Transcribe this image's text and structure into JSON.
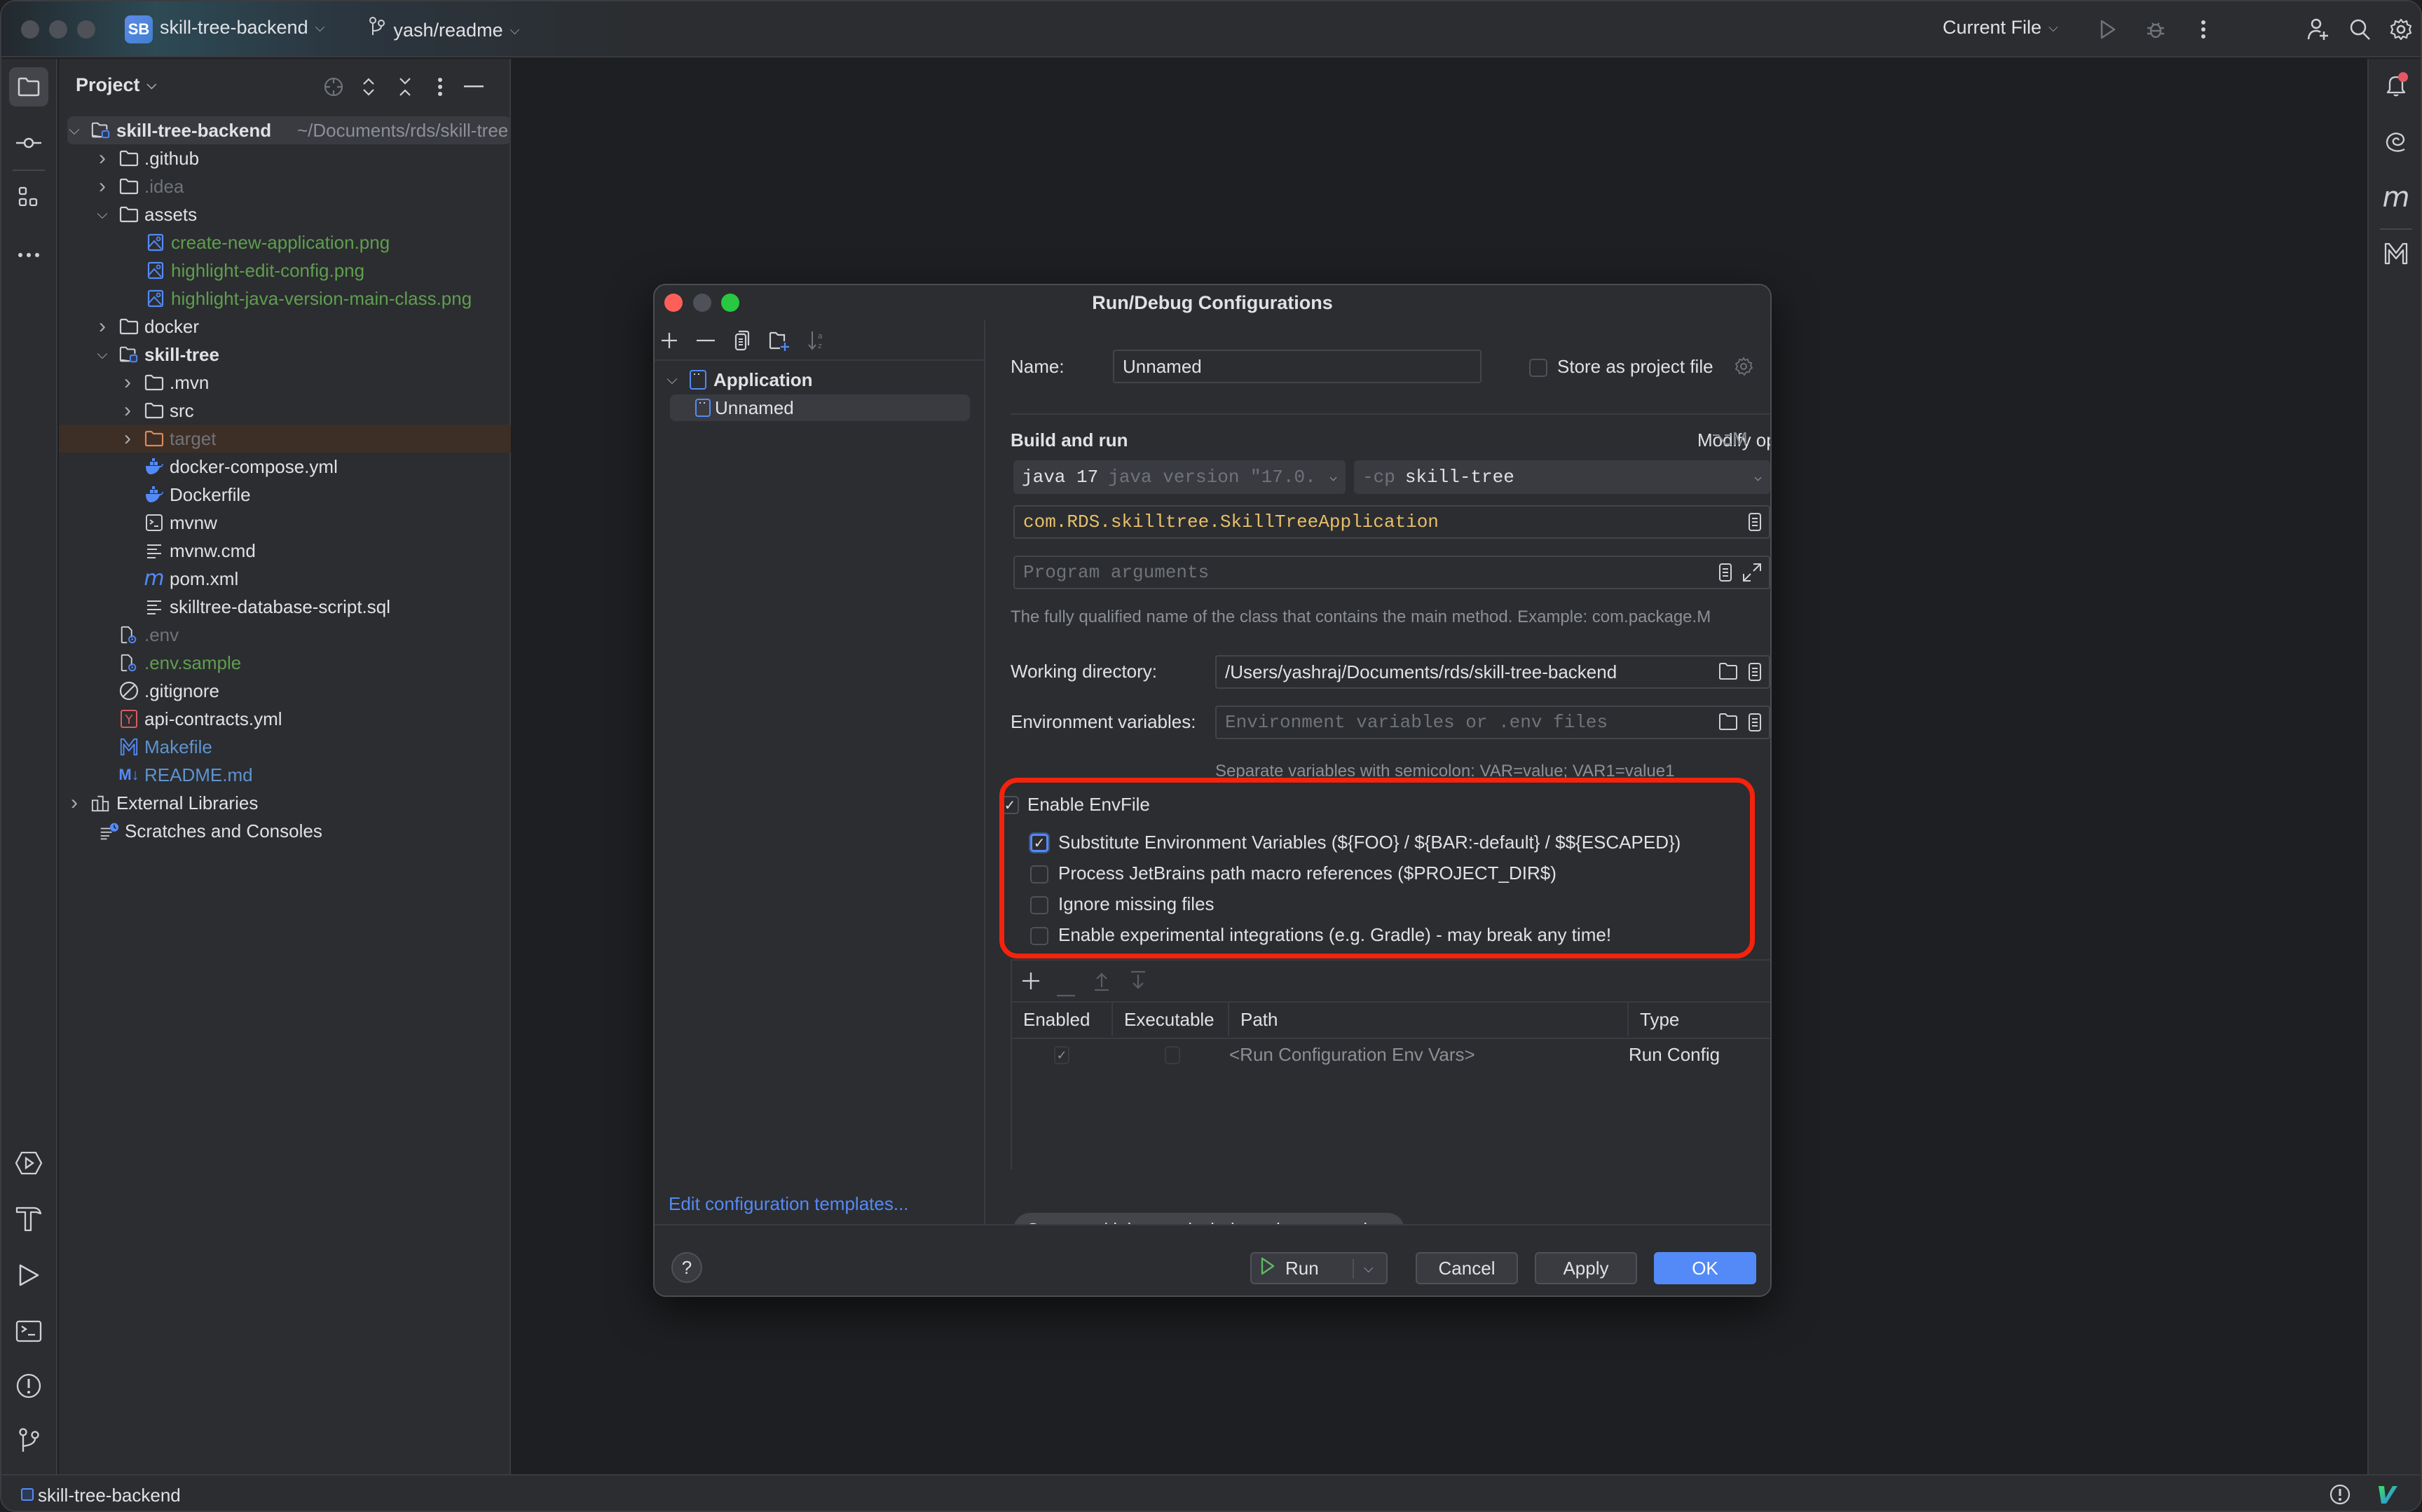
{
  "titlebar": {
    "project_badge": "SB",
    "project_name": "skill-tree-backend",
    "branch": "yash/readme",
    "run_config": "Current File",
    "icons": [
      "run-icon",
      "debug-icon",
      "more-icon",
      "add-user-icon",
      "search-icon",
      "settings-icon"
    ]
  },
  "left_strip": {
    "top_icons": [
      "project-folder-icon",
      "commit-icon",
      "structure-icon",
      "more-tools-icon"
    ],
    "bottom_icons": [
      "services-icon",
      "build-icon",
      "run-icon",
      "terminal-icon",
      "problems-icon",
      "git-icon"
    ]
  },
  "project_panel": {
    "title": "Project",
    "tree": [
      {
        "label": "skill-tree-backend",
        "extra": "~/Documents/rds/skill-tree",
        "depth": 0,
        "arrow": "open",
        "icon": "module-folder-icon",
        "style": "bold"
      },
      {
        "label": ".github",
        "depth": 1,
        "arrow": "closed",
        "icon": "folder-icon",
        "style": "normal"
      },
      {
        "label": ".idea",
        "depth": 1,
        "arrow": "closed",
        "icon": "folder-icon",
        "style": "gray"
      },
      {
        "label": "assets",
        "depth": 1,
        "arrow": "open",
        "icon": "folder-icon",
        "style": "normal"
      },
      {
        "label": "create-new-application.png",
        "depth": 2,
        "arrow": "none",
        "icon": "image-file-icon",
        "style": "green"
      },
      {
        "label": "highlight-edit-config.png",
        "depth": 2,
        "arrow": "none",
        "icon": "image-file-icon",
        "style": "green"
      },
      {
        "label": "highlight-java-version-main-class.png",
        "depth": 2,
        "arrow": "none",
        "icon": "image-file-icon",
        "style": "green"
      },
      {
        "label": "docker",
        "depth": 1,
        "arrow": "closed",
        "icon": "folder-icon",
        "style": "normal"
      },
      {
        "label": "skill-tree",
        "depth": 1,
        "arrow": "open",
        "icon": "module-folder-icon",
        "style": "bold"
      },
      {
        "label": ".mvn",
        "depth": 2,
        "arrow": "closed",
        "icon": "folder-icon",
        "style": "normal"
      },
      {
        "label": "src",
        "depth": 2,
        "arrow": "closed",
        "icon": "folder-icon",
        "style": "normal"
      },
      {
        "label": "target",
        "depth": 2,
        "arrow": "closed",
        "icon": "excluded-folder-icon",
        "style": "gray",
        "excluded": true
      },
      {
        "label": "docker-compose.yml",
        "depth": 3,
        "arrow": "none",
        "icon": "docker-icon",
        "style": "normal"
      },
      {
        "label": "Dockerfile",
        "depth": 3,
        "arrow": "none",
        "icon": "docker-icon",
        "style": "normal"
      },
      {
        "label": "mvnw",
        "depth": 3,
        "arrow": "none",
        "icon": "shell-script-icon",
        "style": "normal"
      },
      {
        "label": "mvnw.cmd",
        "depth": 3,
        "arrow": "none",
        "icon": "text-file-icon",
        "style": "normal"
      },
      {
        "label": "pom.xml",
        "depth": 3,
        "arrow": "none",
        "icon": "maven-icon",
        "style": "normal"
      },
      {
        "label": "skilltree-database-script.sql",
        "depth": 3,
        "arrow": "none",
        "icon": "text-file-icon",
        "style": "normal"
      },
      {
        "label": ".env",
        "depth": 2,
        "arrow": "none",
        "icon": "env-file-icon",
        "style": "gray"
      },
      {
        "label": ".env.sample",
        "depth": 2,
        "arrow": "none",
        "icon": "env-file-icon",
        "style": "green"
      },
      {
        "label": ".gitignore",
        "depth": 2,
        "arrow": "none",
        "icon": "gitignore-icon",
        "style": "normal"
      },
      {
        "label": "api-contracts.yml",
        "depth": 2,
        "arrow": "none",
        "icon": "yaml-icon",
        "style": "normal"
      },
      {
        "label": "Makefile",
        "depth": 2,
        "arrow": "none",
        "icon": "makefile-icon",
        "style": "blue"
      },
      {
        "label": "README.md",
        "depth": 2,
        "arrow": "none",
        "icon": "markdown-icon",
        "style": "blue"
      },
      {
        "label": "External Libraries",
        "depth": 0,
        "arrow": "closed",
        "icon": "libraries-icon",
        "style": "normal"
      },
      {
        "label": "Scratches and Consoles",
        "depth": 0,
        "arrow": "none",
        "icon": "scratches-icon",
        "style": "normal"
      }
    ]
  },
  "right_strip": {
    "icons": [
      "notifications-icon",
      "ai-assistant-icon",
      "maven-icon",
      "makefile-icon"
    ],
    "notification_dot": true
  },
  "statusbar": {
    "project": "skill-tree-backend"
  },
  "dialog": {
    "title": "Run/Debug Configurations",
    "left": {
      "toolbar": [
        "add-icon",
        "remove-icon",
        "copy-icon",
        "new-folder-icon",
        "sort-icon"
      ],
      "tree": [
        {
          "label": "Application",
          "type": "group"
        },
        {
          "label": "Unnamed",
          "type": "item",
          "selected": true
        }
      ],
      "edit_templates_link": "Edit configuration templates..."
    },
    "name_label": "Name:",
    "name_value": "Unnamed",
    "store_as_project_file": "Store as project file",
    "store_checked": false,
    "build_and_run": "Build and run",
    "modify_options": "Modify options",
    "modify_shortcut": "⌥M",
    "jdk": {
      "main": "java 17",
      "detail": "java version \"17.0."
    },
    "classpath": {
      "prefix": "-cp",
      "value": "skill-tree"
    },
    "main_class": "com.RDS.skilltree.SkillTreeApplication",
    "program_args_placeholder": "Program arguments",
    "main_class_hint": "The fully qualified name of the class that contains the main method. Example: com.package.M",
    "working_dir_label": "Working directory:",
    "working_dir_value": "/Users/yashraj/Documents/rds/skill-tree-backend",
    "env_vars_label": "Environment variables:",
    "env_vars_placeholder": "Environment variables or .env files",
    "env_vars_hint": "Separate variables with semicolon: VAR=value; VAR1=value1",
    "envfile": {
      "enable_label": "Enable EnvFile",
      "enable_checked": true,
      "options": [
        {
          "label": "Substitute Environment Variables (${FOO} / ${BAR:-default} / $${ESCAPED})",
          "checked": true,
          "focused": true
        },
        {
          "label": "Process JetBrains path macro references ($PROJECT_DIR$)",
          "checked": false
        },
        {
          "label": "Ignore missing files",
          "checked": false
        },
        {
          "label": "Enable experimental integrations (e.g. Gradle) - may break any time!",
          "checked": false
        }
      ]
    },
    "table": {
      "toolbar": [
        "add-icon",
        "remove-icon",
        "move-up-icon",
        "move-down-icon"
      ],
      "columns": [
        "Enabled",
        "Executable",
        "Path",
        "Type"
      ],
      "rows": [
        {
          "enabled": true,
          "executable": false,
          "path": "<Run Configuration Env Vars>",
          "type": "Run Config"
        }
      ]
    },
    "chip": "Open run/debug tool window when started",
    "buttons": {
      "help": "?",
      "run": "Run",
      "cancel": "Cancel",
      "apply": "Apply",
      "ok": "OK"
    }
  },
  "colors": {
    "accent": "#548af7",
    "highlight_box": "#f4230d",
    "main_class_text": "#e8bf6a",
    "green_file": "#5f9e4e"
  }
}
